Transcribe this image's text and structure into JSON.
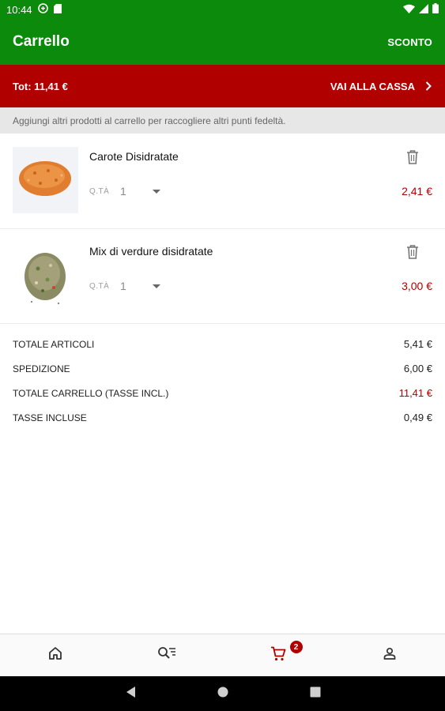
{
  "status_bar": {
    "time": "10:44"
  },
  "app_bar": {
    "title": "Carrello",
    "action_label": "SCONTO"
  },
  "total_bar": {
    "total_text": "Tot: 11,41 €",
    "checkout_label": "VAI ALLA CASSA"
  },
  "info_message": "Aggiungi altri prodotti al carrello per raccogliere altri punti fedeltà.",
  "cart_items": [
    {
      "name": "Carote Disidratate",
      "qty_label": "Q.TÀ",
      "qty": "1",
      "price": "2,41 €",
      "image_icon": "carrot-flakes-image"
    },
    {
      "name": "Mix di verdure disidratate",
      "qty_label": "Q.TÀ",
      "qty": "1",
      "price": "3,00 €",
      "image_icon": "vegetable-mix-image"
    }
  ],
  "summary": [
    {
      "label": "TOTALE ARTICOLI",
      "value": "5,41 €"
    },
    {
      "label": "SPEDIZIONE",
      "value": "6,00 €"
    },
    {
      "label": "TOTALE CARRELLO (TASSE INCL.)",
      "value": "11,41 €"
    },
    {
      "label": "TASSE INCLUSE",
      "value": "0,49 €"
    }
  ],
  "bottom_nav": {
    "cart_badge": "2"
  },
  "colors": {
    "green": "#0c8a0c",
    "red": "#b00000",
    "info_bg": "#e7e7e7"
  }
}
